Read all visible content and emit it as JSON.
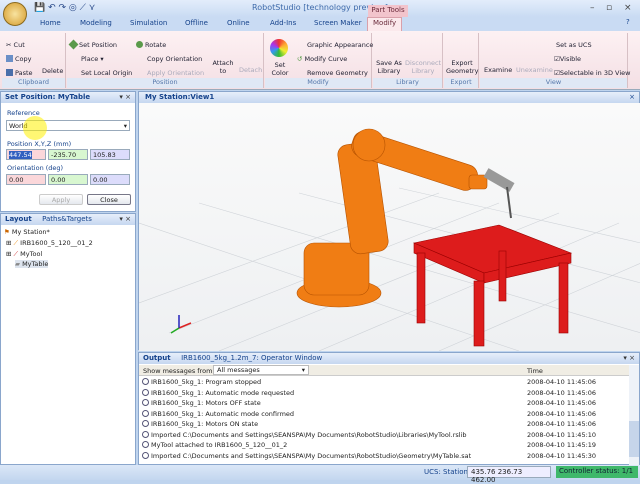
{
  "app": {
    "title": "RobotStudio [technology preview]",
    "context_group": "Part Tools"
  },
  "tabs": [
    "Home",
    "Modeling",
    "Simulation",
    "Offline",
    "Online",
    "Add-Ins",
    "Screen Maker",
    "Modify"
  ],
  "ribbon": {
    "clipboard": {
      "label": "Clipboard",
      "cut": "Cut",
      "copy": "Copy",
      "paste": "Paste",
      "delete": "Delete"
    },
    "position": {
      "label": "Position",
      "set_position": "Set Position",
      "rotate": "Rotate",
      "place": "Place",
      "copy_orientation": "Copy Orientation",
      "set_local_origin": "Set Local Origin",
      "apply_orientation": "Apply Orientation",
      "attach_to": "Attach to",
      "detach": "Detach"
    },
    "modify": {
      "label": "Modify",
      "set_color": "Set Color",
      "graphic_appearance": "Graphic Appearance",
      "modify_curve": "Modify Curve",
      "remove_geometry": "Remove Geometry"
    },
    "library": {
      "label": "Library",
      "save_as_library": "Save As Library",
      "disconnect_library": "Disconnect Library"
    },
    "export": {
      "label": "Export",
      "export_geometry": "Export Geometry"
    },
    "view": {
      "label": "View",
      "examine": "Examine",
      "unexamine": "Unexamine",
      "set_as_ucs": "Set as UCS",
      "visible": "Visible",
      "selectable": "Selectable in 3D View"
    }
  },
  "set_position": {
    "title": "Set Position: MyTable",
    "reference_label": "Reference",
    "reference_value": "World",
    "position_label": "Position X,Y,Z (mm)",
    "pos_x": "447.54",
    "pos_y": "-235.70",
    "pos_z": "105.83",
    "orientation_label": "Orientation (deg)",
    "rx": "0.00",
    "ry": "0.00",
    "rz": "0.00",
    "apply": "Apply",
    "close": "Close"
  },
  "layout": {
    "tabs": [
      "Layout",
      "Paths&Targets"
    ],
    "root": "My Station*",
    "items": [
      "IRB1600_5_120__01_2",
      "MyTool",
      "MyTable"
    ]
  },
  "viewport": {
    "title": "My Station:View1",
    "robot_color": "#f07d14",
    "table_color": "#dd1c1c"
  },
  "output": {
    "tabs": [
      "Output",
      "IRB1600_5kg_1.2m_7: Operator Window"
    ],
    "filter_label": "Show messages from:",
    "filter_value": "All messages",
    "time_header": "Time",
    "rows": [
      {
        "msg": "IRB1600_5kg_1: Program stopped",
        "time": "2008-04-10 11:45:06"
      },
      {
        "msg": "IRB1600_5kg_1: Automatic mode requested",
        "time": "2008-04-10 11:45:06"
      },
      {
        "msg": "IRB1600_5kg_1: Motors OFF state",
        "time": "2008-04-10 11:45:06"
      },
      {
        "msg": "IRB1600_5kg_1: Automatic mode confirmed",
        "time": "2008-04-10 11:45:06"
      },
      {
        "msg": "IRB1600_5kg_1: Motors ON state",
        "time": "2008-04-10 11:45:06"
      },
      {
        "msg": "Imported C:\\Documents and Settings\\SEANSPA\\My Documents\\RobotStudio\\Libraries\\MyTool.rslib",
        "time": "2008-04-10 11:45:10"
      },
      {
        "msg": "MyTool attached to IRB1600_5_120__01_2",
        "time": "2008-04-10 11:45:19"
      },
      {
        "msg": "Imported C:\\Documents and Settings\\SEANSPA\\My Documents\\RobotStudio\\Geometry\\MyTable.sat",
        "time": "2008-04-10 11:45:30"
      }
    ]
  },
  "status": {
    "ucs": "UCS: Station",
    "coords": "435.76  236.73  462.00",
    "controller": "Controller status: 1/1"
  }
}
